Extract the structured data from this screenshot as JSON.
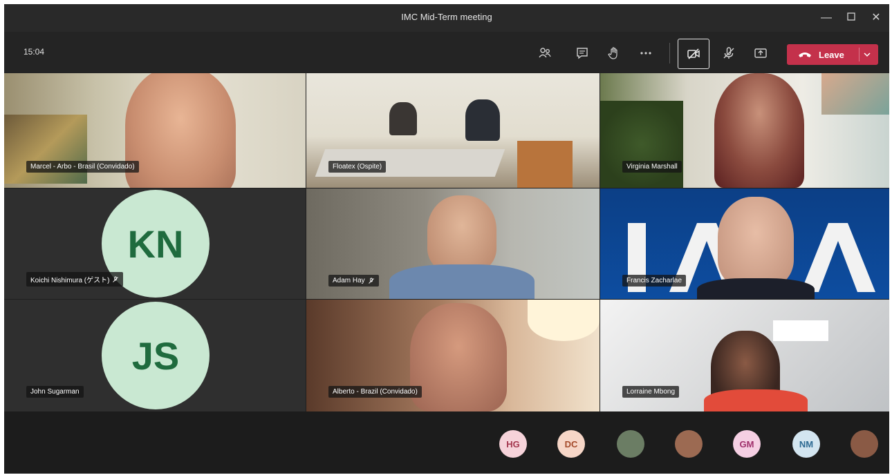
{
  "window": {
    "title": "IMC Mid-Term meeting"
  },
  "toolbar": {
    "time": "15:04",
    "leave_label": "Leave"
  },
  "tiles": [
    {
      "name": "Marcel - Arbo - Brasil (Convidado)"
    },
    {
      "name": "Floatex (Ospite)"
    },
    {
      "name": "Virginia Marshall"
    },
    {
      "name": "Koichi Nishimura (ゲスト)",
      "initials": "KN"
    },
    {
      "name": "Adam Hay"
    },
    {
      "name": "Francis Zacharlae"
    },
    {
      "name": "John Sugarman",
      "initials": "JS"
    },
    {
      "name": "Alberto - Brazil (Convidado)"
    },
    {
      "name": "Lorraine Mbong"
    }
  ],
  "overflow_participants": [
    {
      "initials": "HG",
      "bg": "#f6d3da",
      "fg": "#a4374f"
    },
    {
      "initials": "DC",
      "bg": "#f6d6c7",
      "fg": "#a44a2a"
    },
    {
      "initials": "",
      "bg": "#6b7d64",
      "fg": "#fff"
    },
    {
      "initials": "",
      "bg": "#9c6a52",
      "fg": "#fff"
    },
    {
      "initials": "GM",
      "bg": "#f5cfe3",
      "fg": "#a0306c"
    },
    {
      "initials": "NM",
      "bg": "#d3e5f0",
      "fg": "#2d6a93"
    },
    {
      "initials": "",
      "bg": "#8a5a45",
      "fg": "#fff"
    }
  ],
  "colors": {
    "leave": "#c4314b",
    "avatar_bg": "#c9e8d2",
    "avatar_fg": "#1f6b3e"
  }
}
